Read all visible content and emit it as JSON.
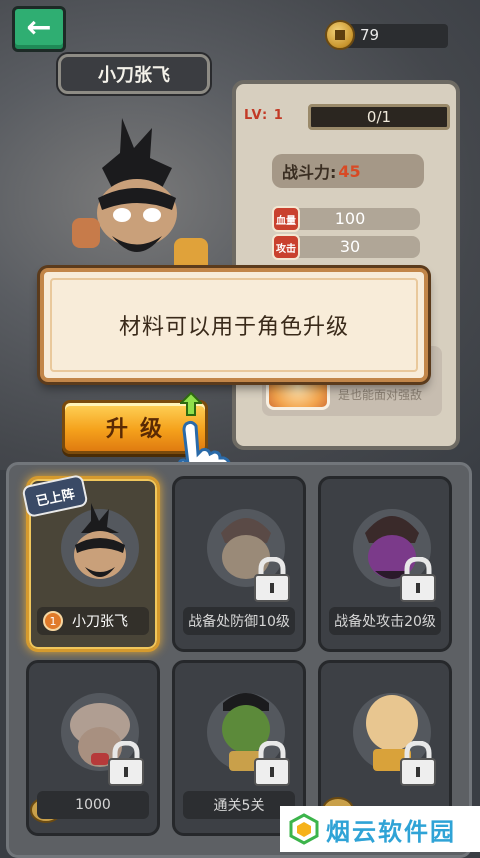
{
  "header": {
    "coins": "79"
  },
  "hero": {
    "name": "小刀张飞",
    "level_label": "LV: 1",
    "exp": "0/1",
    "power_label": "战斗力:",
    "power_value": "45",
    "stats": [
      {
        "icon": "血量",
        "value": "100"
      },
      {
        "icon": "攻击",
        "value": "30"
      }
    ],
    "skill_text": "是也能面对强敌"
  },
  "dialog": {
    "message": "材料可以用于角色升级"
  },
  "upgrade_button": {
    "label": "升级"
  },
  "roster": {
    "deployed_tag": "已上阵",
    "cards": [
      {
        "label": "小刀张飞",
        "level": "1",
        "locked": false,
        "selected": true
      },
      {
        "label": "战备处防御10级",
        "locked": true
      },
      {
        "label": "战备处攻击20级",
        "locked": true
      },
      {
        "label": "1000",
        "locked": true
      },
      {
        "label": "通关5关",
        "locked": true
      },
      {
        "label": "",
        "locked": true
      }
    ]
  },
  "watermark": {
    "text": "烟云软件园"
  },
  "colors": {
    "accent_green": "#2fae72",
    "button_orange": "#f5a21c",
    "power_red": "#d84a25",
    "selected_gold": "#d59a2e"
  }
}
